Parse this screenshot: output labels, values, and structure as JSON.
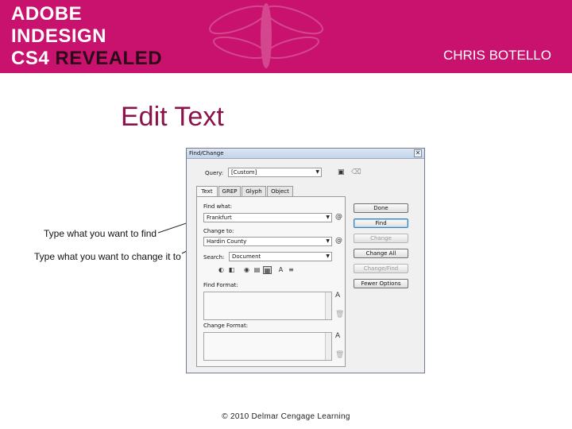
{
  "banner": {
    "brand_line1": "ADOBE",
    "brand_line2": "INDESIGN",
    "brand_cs": "CS4",
    "brand_revealed": "REVEALED",
    "author": "CHRIS BOTELLO",
    "color": "#c8126e"
  },
  "slide": {
    "title": "Edit Text"
  },
  "callouts": {
    "find": "Type what you want to find",
    "change": "Type what you want to change it to"
  },
  "dialog": {
    "title": "Find/Change",
    "close_glyph": "✕",
    "query_label": "Query:",
    "query_value": "[Custom]",
    "tabs": [
      "Text",
      "GREP",
      "Glyph",
      "Object"
    ],
    "find_what_label": "Find what:",
    "find_what_value": "Frankfurt",
    "change_to_label": "Change to:",
    "change_to_value": "Hardin County",
    "search_label": "Search:",
    "search_value": "Document",
    "find_format_label": "Find Format:",
    "change_format_label": "Change Format:",
    "buttons": {
      "done": "Done",
      "find": "Find",
      "change": "Change",
      "change_all": "Change All",
      "change_find": "Change/Find",
      "fewer_options": "Fewer Options"
    },
    "icons": [
      "save-query-icon",
      "delete-query-icon",
      "special-characters-icon",
      "info-icon",
      "trash-icon"
    ]
  },
  "footer": {
    "copyright": "© 2010 Delmar Cengage Learning"
  }
}
